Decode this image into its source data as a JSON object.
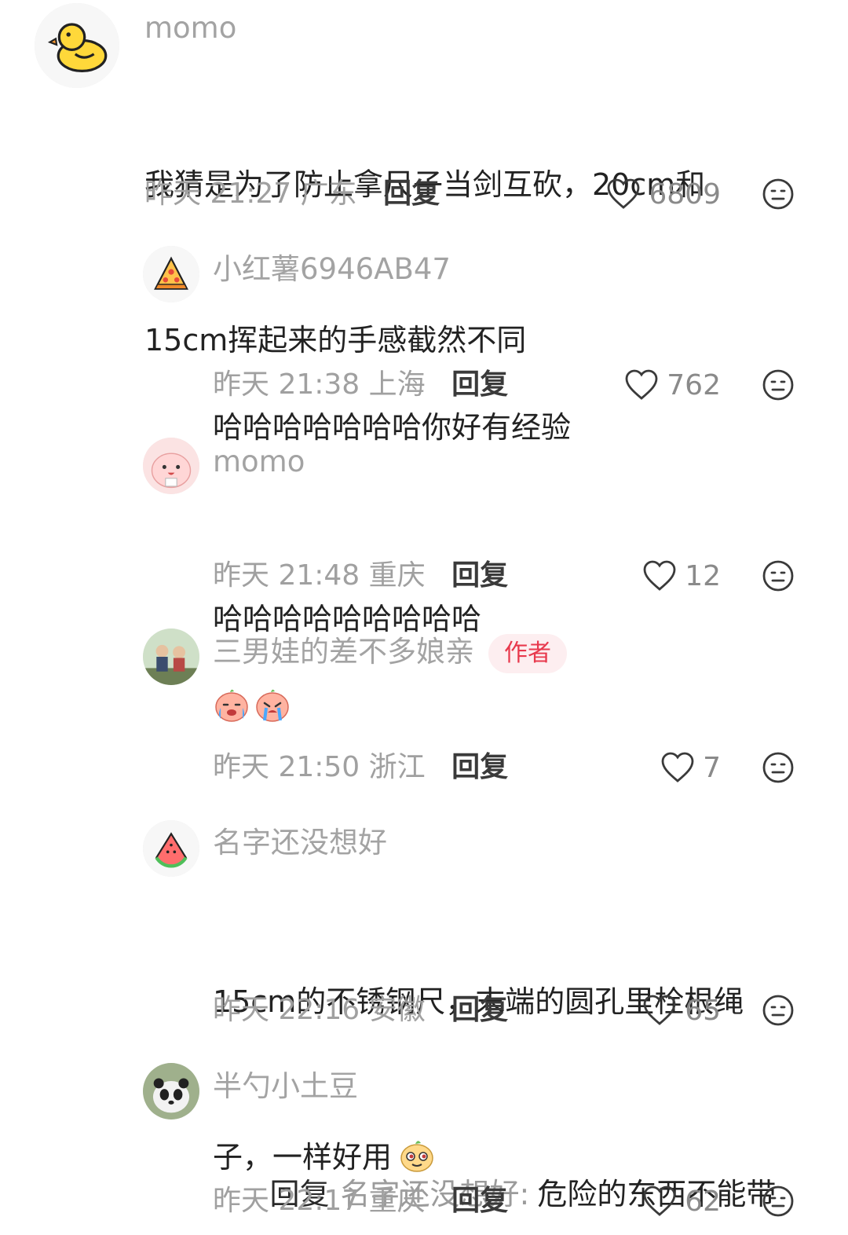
{
  "comments": [
    {
      "avatar": "duck-avatar",
      "name": "momo",
      "text_lines": [
        "我猜是为了防止拿尺子当剑互砍，20cm和",
        "15cm挥起来的手感截然不同"
      ],
      "time": "昨天 21:27",
      "region": "广东",
      "reply_label": "回复",
      "likes": "6809"
    },
    {
      "avatar": "pizza-avatar",
      "name": "小红薯6946AB47",
      "text_lines": [
        "哈哈哈哈哈哈哈你好有经验"
      ],
      "time": "昨天 21:38",
      "region": "上海",
      "reply_label": "回复",
      "likes": "762"
    },
    {
      "avatar": "pink-character-avatar",
      "name": "momo",
      "text_lines": [
        "哈哈哈哈哈哈哈哈哈"
      ],
      "time": "昨天 21:48",
      "region": "重庆",
      "reply_label": "回复",
      "likes": "12"
    },
    {
      "avatar": "kids-photo-avatar",
      "name": "三男娃的差不多娘亲",
      "badge": "作者",
      "emojis": [
        "crying-face-emoji",
        "crying-face-emoji"
      ],
      "time": "昨天 21:50",
      "region": "浙江",
      "reply_label": "回复",
      "likes": "7"
    },
    {
      "avatar": "watermelon-avatar",
      "name": "名字还没想好",
      "text_lines": [
        "15cm的不锈钢尺，末端的圆孔里栓根绳",
        "子，一样好用"
      ],
      "trailing_emoji": "smug-face-emoji",
      "time": "昨天 22:16",
      "region": "安徽",
      "reply_label": "回复",
      "likes": "65"
    },
    {
      "avatar": "panda-avatar",
      "name": "半勺小土豆",
      "reply_prefix": "回复",
      "reply_target": "名字还没想好:",
      "reply_text": "危险的东西不能带",
      "time": "昨天 22:17",
      "region": "重庆",
      "reply_label": "回复",
      "likes": "62"
    }
  ],
  "icons": {
    "like": "heart-outline-icon",
    "react": "meh-face-icon"
  },
  "colors": {
    "author_badge_bg": "#fdeef0",
    "author_badge_text": "#e8394d",
    "meta_text": "#a0a0a0",
    "name_text": "#a3a3a3"
  }
}
